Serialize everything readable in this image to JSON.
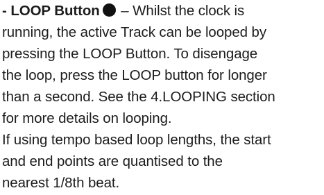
{
  "paragraph1": {
    "heading": "- LOOP Button",
    "heading_tail": " – Whilst the clock is",
    "lines": [
      "running, the active Track can be looped by",
      "pressing the LOOP Button. To disengage",
      "the loop, press the LOOP button for longer",
      "than a second. See the 4.LOOPING section",
      "for more details on looping."
    ]
  },
  "paragraph2": {
    "lines": [
      "If using tempo based loop lengths, the start",
      "and end points are quantised to the",
      "nearest 1/8th beat."
    ]
  },
  "icons": {
    "loop_button": "filled-circle"
  },
  "colors": {
    "text": "#1c1c1c",
    "background": "#ffffff"
  }
}
